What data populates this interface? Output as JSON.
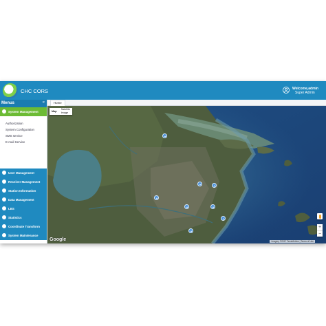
{
  "header": {
    "app_title": "CHC CORS",
    "welcome": "Welcome,admin",
    "role": "Super Admin"
  },
  "sidebar": {
    "menus_label": "Menus",
    "active_section": {
      "label": "System Management",
      "items": [
        "Authorization",
        "System Configuration",
        "SMS service",
        "E-mail Service"
      ]
    },
    "sections": [
      {
        "label": "User Management"
      },
      {
        "label": "Receiver Management"
      },
      {
        "label": "Station Information"
      },
      {
        "label": "Data Management"
      },
      {
        "label": "LBS"
      },
      {
        "label": "Statistics"
      },
      {
        "label": "Coordinate Transform"
      },
      {
        "label": "System Maintenance"
      }
    ]
  },
  "tabs": {
    "home": "Home"
  },
  "map": {
    "type_map": "Map",
    "type_satellite": "Satellite",
    "type_satellite_sub": "Image",
    "google": "Google",
    "attribution": "Imagery ©2017 TerraMetrics  |  Terms of Use",
    "zoom_in": "+",
    "zoom_out": "−",
    "station_count": 11
  },
  "colors": {
    "header_blue": "#1f8ac0",
    "active_green": "#6cbb34",
    "marker_blue": "#4a90d9"
  }
}
